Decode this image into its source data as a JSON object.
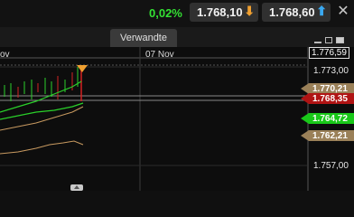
{
  "header": {
    "change_percent": "0,02%",
    "bid": "1.768,10",
    "ask": "1.768,60",
    "close_symbol": "✕"
  },
  "tabs": [
    {
      "label": "Verwandte"
    }
  ],
  "chart_dates": [
    "ov",
    "07 Nov"
  ],
  "price_axis": {
    "cursor_value": "1.776,59",
    "labels": [
      "1.773,00",
      "1.757,00"
    ],
    "tags": [
      {
        "value": "1.770,21",
        "color": "#9a8058",
        "text_color": "#ffffff"
      },
      {
        "value": "1.768,35",
        "color": "#b01414",
        "text_color": "#ffffff"
      },
      {
        "value": "1.764,72",
        "color": "#19c819",
        "text_color": "#ffffff"
      },
      {
        "value": "1.762,21",
        "color": "#9a8058",
        "text_color": "#ffffff"
      }
    ]
  },
  "colors": {
    "positive": "#33e033",
    "up_candle": "#2ad02a",
    "down_candle": "#d42222",
    "ma_line": "#c89a60",
    "marker": "#f0a030"
  }
}
